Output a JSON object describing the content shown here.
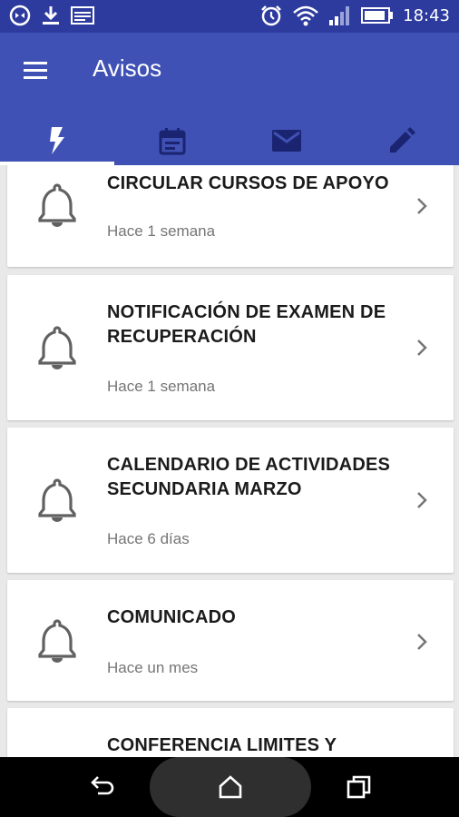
{
  "status_bar": {
    "time": "18:43",
    "icons": [
      "sync-icon",
      "download-icon",
      "image-icon",
      "alarm-icon",
      "wifi-icon",
      "signal-icon",
      "battery-icon"
    ]
  },
  "app_bar": {
    "title": "Avisos",
    "tabs": [
      {
        "icon": "flash-icon",
        "selected": true
      },
      {
        "icon": "calendar-icon",
        "selected": false
      },
      {
        "icon": "mail-icon",
        "selected": false
      },
      {
        "icon": "edit-icon",
        "selected": false
      }
    ],
    "color": "#3f51b5",
    "status_color": "#2d3b9e"
  },
  "notices": [
    {
      "title": "CIRCULAR CURSOS DE APOYO",
      "time": "Hace 1 semana"
    },
    {
      "title": "NOTIFICACIÓN DE EXAMEN DE RECUPERACIÓN",
      "time": "Hace 1 semana"
    },
    {
      "title": "CALENDARIO DE ACTIVIDADES SECUNDARIA MARZO",
      "time": "Hace 6 días"
    },
    {
      "title": "COMUNICADO",
      "time": "Hace un mes"
    },
    {
      "title": "CONFERENCIA LIMITES Y",
      "time": ""
    }
  ],
  "nav_bar": {
    "buttons": [
      "back-icon",
      "home-icon",
      "recents-icon"
    ]
  }
}
